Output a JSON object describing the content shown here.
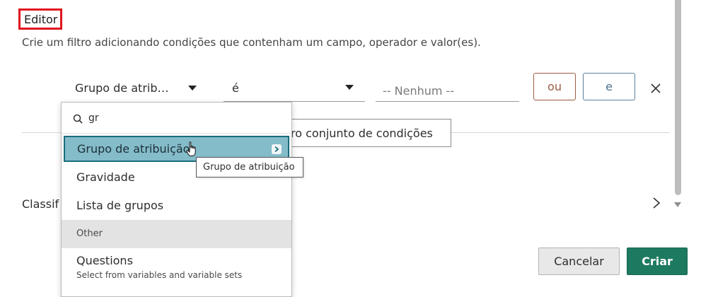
{
  "editor": {
    "title": "Editor",
    "description": "Crie um filtro adicionando condições que contenham um campo, operador e valor(es)."
  },
  "condition": {
    "field_value": "Grupo de atrib…",
    "operator_value": "é",
    "value_placeholder": "-- Nenhum --",
    "or_label": "ou",
    "and_label": "e",
    "new_condition_set_label": "ro conjunto de condições"
  },
  "sort": {
    "label": "Classif"
  },
  "dropdown": {
    "search_query": "gr",
    "items": [
      {
        "label": "Grupo de atribuição"
      },
      {
        "label": "Gravidade"
      },
      {
        "label": "Lista de grupos"
      }
    ],
    "group_header": "Other",
    "questions": {
      "label": "Questions",
      "description": "Select from variables and variable sets"
    }
  },
  "tooltip": {
    "text": "Grupo de atribuição"
  },
  "footer": {
    "cancel_label": "Cancelar",
    "create_label": "Criar"
  },
  "colors": {
    "highlight_fill": "#84bcc9",
    "highlight_border": "#1a6c7c",
    "create_button": "#1d7a60",
    "annotation_box": "#e0141e"
  }
}
